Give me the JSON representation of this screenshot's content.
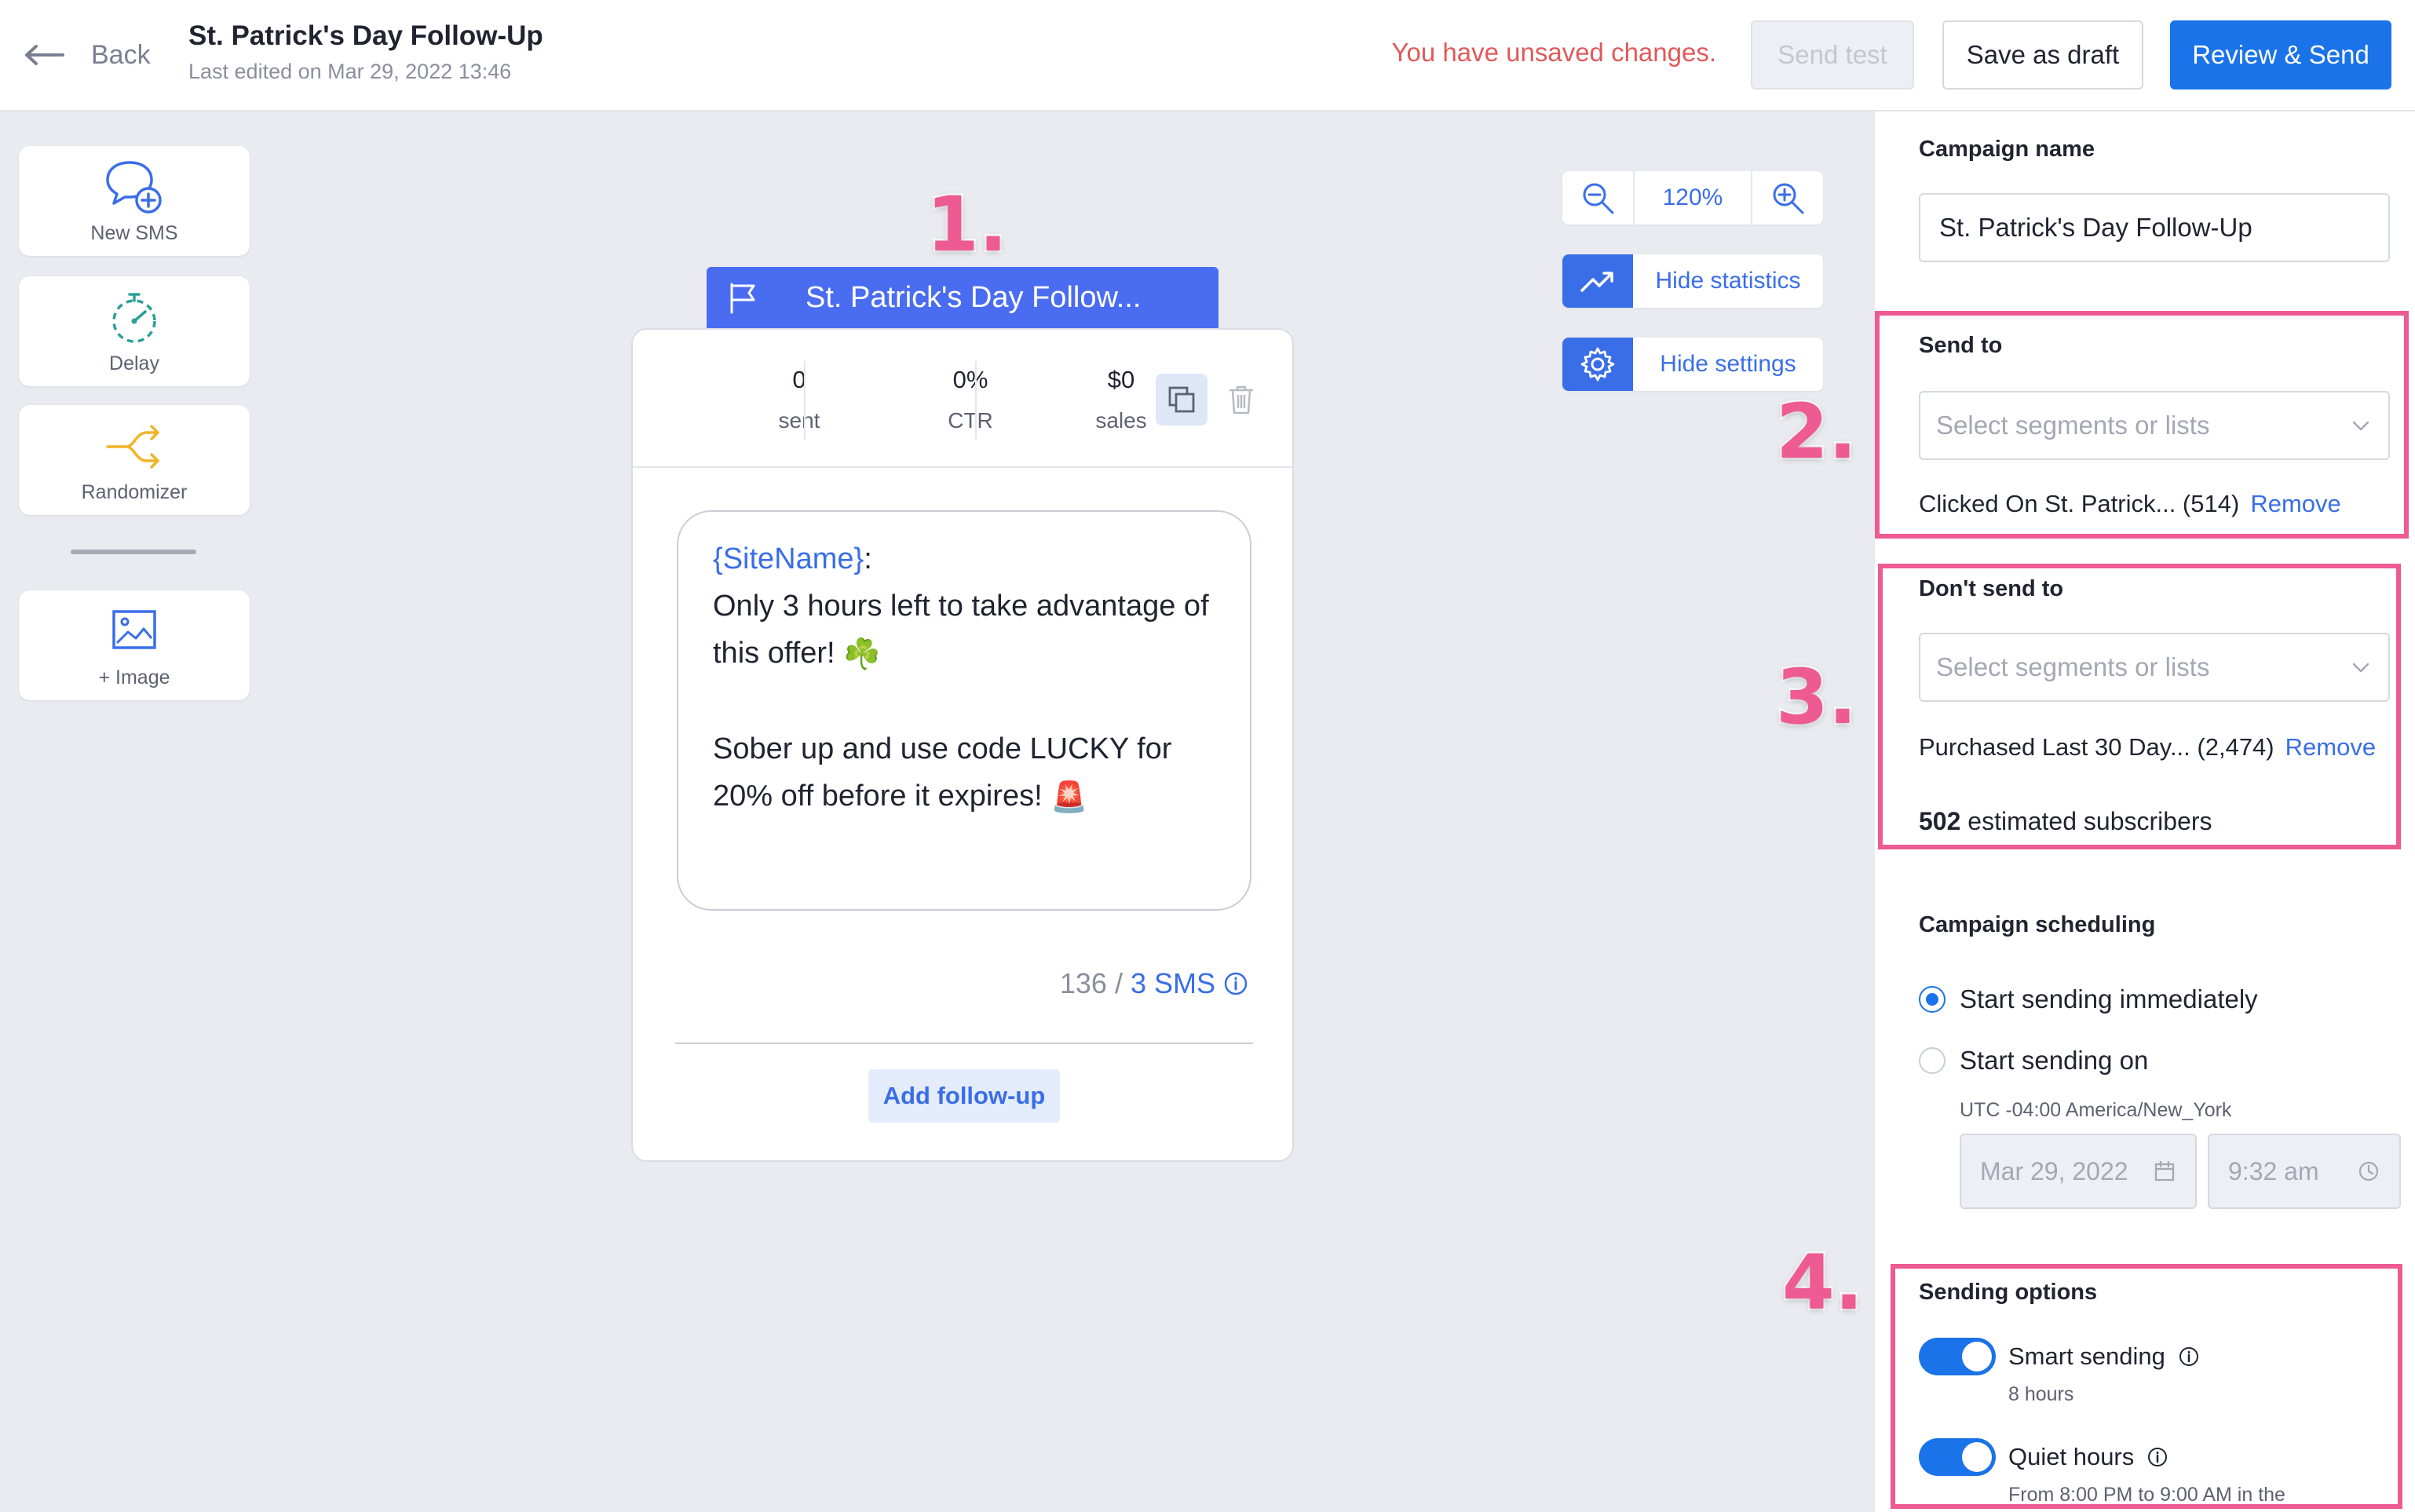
{
  "header": {
    "back_label": "Back",
    "title": "St. Patrick's Day Follow-Up",
    "last_edited": "Last edited on Mar 29, 2022 13:46",
    "unsaved_notice": "You have unsaved changes.",
    "send_test_label": "Send test",
    "save_draft_label": "Save as draft",
    "review_send_label": "Review & Send"
  },
  "tools": [
    {
      "label": "New SMS",
      "icon": "new-sms-icon"
    },
    {
      "label": "Delay",
      "icon": "timer-icon"
    },
    {
      "label": "Randomizer",
      "icon": "split-arrows-icon"
    },
    {
      "label": "+ Image",
      "icon": "image-icon"
    }
  ],
  "canvas": {
    "zoom_level": "120%",
    "hide_statistics_label": "Hide statistics",
    "hide_settings_label": "Hide settings"
  },
  "annotations": [
    "1.",
    "2.",
    "3.",
    "4."
  ],
  "card": {
    "tab_title": "St. Patrick's Day Follow...",
    "stats": [
      {
        "value": "0",
        "label": "sent"
      },
      {
        "value": "0%",
        "label": "CTR"
      },
      {
        "value": "$0",
        "label": "sales"
      }
    ],
    "message": {
      "tag": "{SiteName}",
      "tag_suffix": ":",
      "line1": "Only 3 hours left to take advantage of this offer!",
      "emoji1": "☘️",
      "line2": "Sober up and use code LUCKY for 20% off before it expires!",
      "emoji2": "🚨"
    },
    "char_count": "136 /",
    "sms_count": "3 SMS",
    "add_followup_label": "Add follow-up"
  },
  "settings": {
    "campaign_name_label": "Campaign name",
    "campaign_name_value": "St. Patrick's Day Follow-Up",
    "send_to_label": "Send to",
    "send_to_placeholder": "Select segments or lists",
    "send_to_item": "Clicked On St. Patrick... (514)",
    "remove_label": "Remove",
    "dont_send_label": "Don't send to",
    "dont_send_placeholder": "Select segments or lists",
    "dont_send_item": "Purchased Last 30 Day... (2,474)",
    "estimated_count": "502",
    "estimated_suffix": "estimated subscribers",
    "scheduling_label": "Campaign scheduling",
    "opt_immediate": "Start sending immediately",
    "opt_on": "Start sending on",
    "timezone": "UTC -04:00 America/New_York",
    "date_value": "Mar 29, 2022",
    "time_value": "9:32 am",
    "sending_options_label": "Sending options",
    "smart_sending_label": "Smart sending",
    "smart_sending_sub": "8 hours",
    "quiet_hours_label": "Quiet hours",
    "quiet_hours_sub": "From 8:00 PM to 9:00 AM in the"
  },
  "colors": {
    "accent": "#1a73e8",
    "annotation": "#ee5a92",
    "warning": "#e05a5a"
  }
}
